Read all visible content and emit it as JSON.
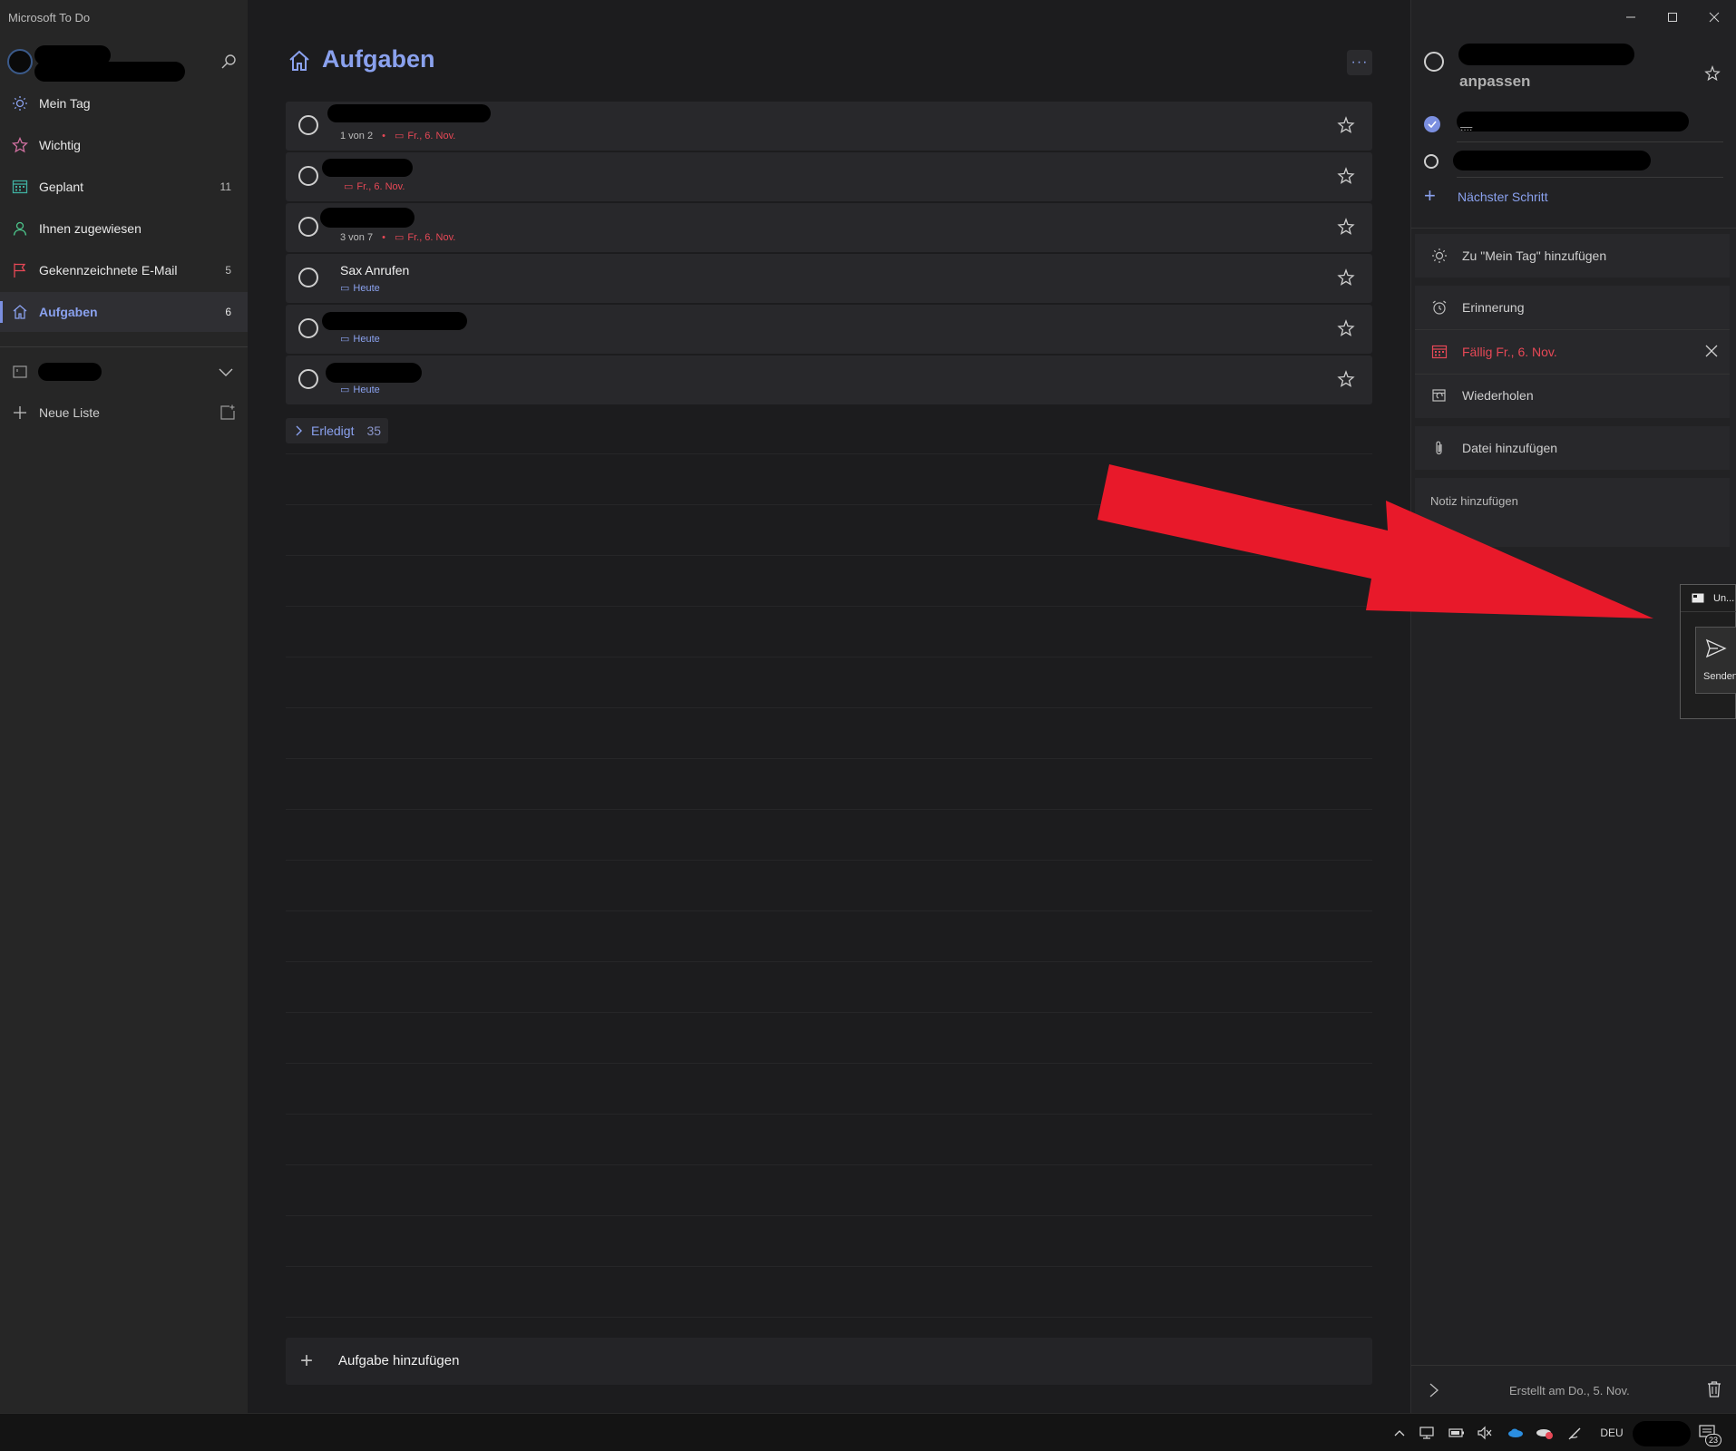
{
  "window": {
    "title": "Microsoft To Do"
  },
  "sidebar": {
    "items": [
      {
        "label": "Mein Tag",
        "count": "",
        "icon": "sun-icon"
      },
      {
        "label": "Wichtig",
        "count": "",
        "icon": "star-icon"
      },
      {
        "label": "Geplant",
        "count": "11",
        "icon": "calendar-icon"
      },
      {
        "label": "Ihnen zugewiesen",
        "count": "",
        "icon": "person-icon"
      },
      {
        "label": "Gekennzeichnete E-Mail",
        "count": "5",
        "icon": "flag-icon"
      },
      {
        "label": "Aufgaben",
        "count": "6",
        "icon": "home-icon"
      }
    ],
    "new_list_label": "Neue Liste"
  },
  "main": {
    "title": "Aufgaben",
    "more_label": "···",
    "tasks": [
      {
        "title": "",
        "steps": "1 von 2",
        "due": "Fr., 6. Nov.",
        "due_color": "red"
      },
      {
        "title": "",
        "steps": "",
        "due": "Fr., 6. Nov.",
        "due_color": "red"
      },
      {
        "title": "",
        "steps": "3 von 7",
        "due": "Fr., 6. Nov.",
        "due_color": "red"
      },
      {
        "title": "Sax Anrufen",
        "steps": "",
        "due": "Heute",
        "due_color": "blue"
      },
      {
        "title": "",
        "steps": "",
        "due": "Heute",
        "due_color": "blue"
      },
      {
        "title": "",
        "steps": "",
        "due": "Heute",
        "due_color": "blue"
      }
    ],
    "completed": {
      "label": "Erledigt",
      "count": "35"
    },
    "add_task_label": "Aufgabe hinzufügen"
  },
  "detail": {
    "title_line2": "anpassen",
    "step1_text": "....",
    "next_step_label": "Nächster Schritt",
    "add_my_day_label": "Zu \"Mein Tag\" hinzufügen",
    "reminder_label": "Erinnerung",
    "due_label": "Fällig Fr., 6. Nov.",
    "repeat_label": "Wiederholen",
    "file_label": "Datei hinzufügen",
    "note_placeholder": "Notiz hinzufügen",
    "created_label": "Erstellt am Do., 5. Nov."
  },
  "mini_window": {
    "title": "Un...",
    "send_label": "Senden"
  },
  "taskbar": {
    "language": "DEU",
    "notification_count": "23"
  },
  "colors": {
    "accent": "#8aa1ee",
    "due_red": "#e74856",
    "arrow_red": "#e8192a"
  }
}
